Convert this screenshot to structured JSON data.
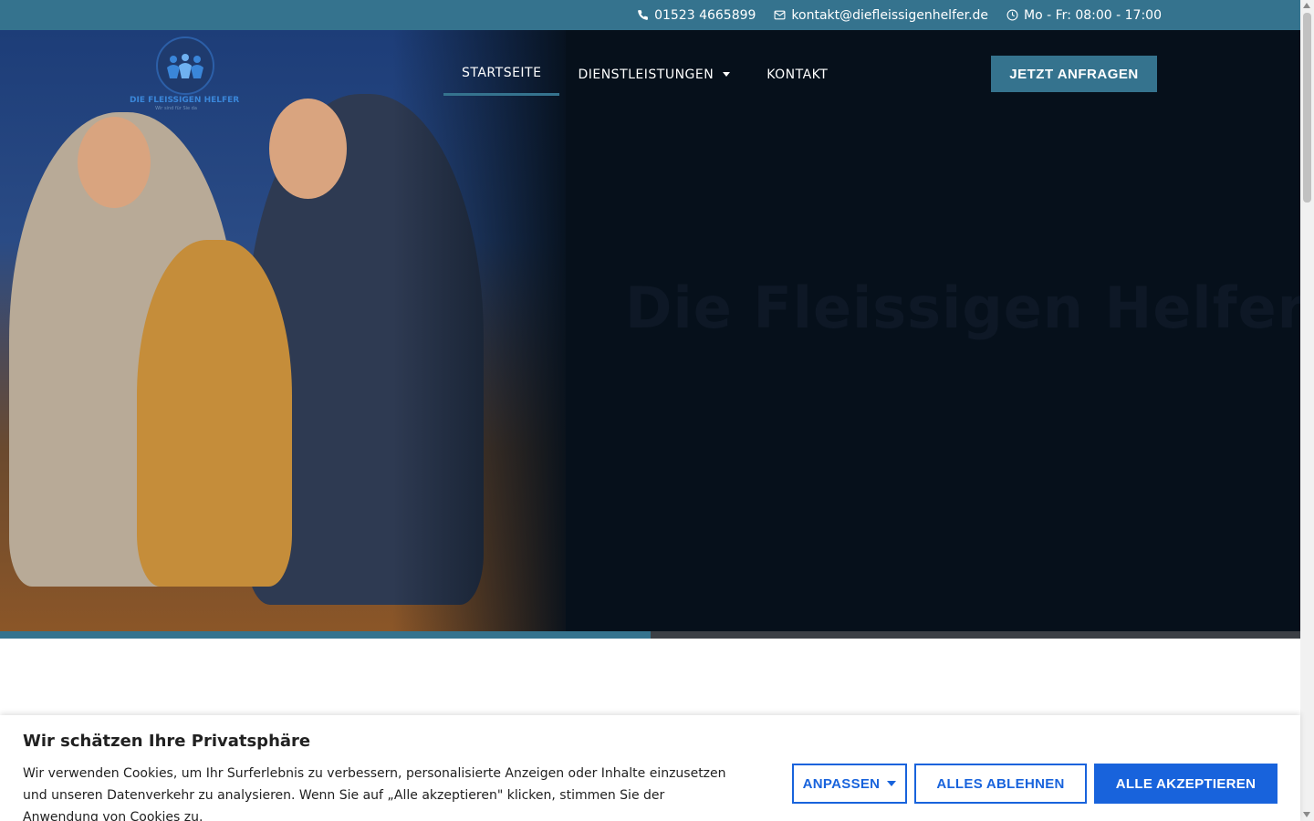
{
  "topbar": {
    "phone": "01523 4665899",
    "email": "kontakt@diefleissigenhelfer.de",
    "hours": "Mo - Fr: 08:00 - 17:00"
  },
  "logo": {
    "name": "DIE FLEISSIGEN HELFER",
    "tagline": "Wir sind für Sie da"
  },
  "nav": {
    "items": [
      {
        "label": "STARTSEITE"
      },
      {
        "label": "DIENSTLEISTUNGEN"
      },
      {
        "label": "KONTAKT"
      }
    ]
  },
  "header": {
    "cta_label": "JETZT ANFRAGEN"
  },
  "hero": {
    "title": "Die Fleissigen Helfer",
    "slider_progress": 0.5
  },
  "cookie": {
    "title": "Wir schätzen Ihre Privatsphäre",
    "text": "Wir verwenden Cookies, um Ihr Surferlebnis zu verbessern, personalisierte Anzeigen oder Inhalte einzusetzen und unseren Datenverkehr zu analysieren. Wenn Sie auf „Alle akzeptieren\" klicken, stimmen Sie der Anwendung von Cookies zu.",
    "customize_label": "ANPASSEN",
    "reject_label": "ALLES ABLEHNEN",
    "accept_label": "ALLE AKZEPTIEREN"
  },
  "colors": {
    "accent": "#35738e",
    "hero_bg": "#06101b",
    "cookie_blue": "#1863dc"
  },
  "icons": [
    "phone-icon",
    "envelope-icon",
    "clock-icon",
    "chevron-down-icon"
  ]
}
